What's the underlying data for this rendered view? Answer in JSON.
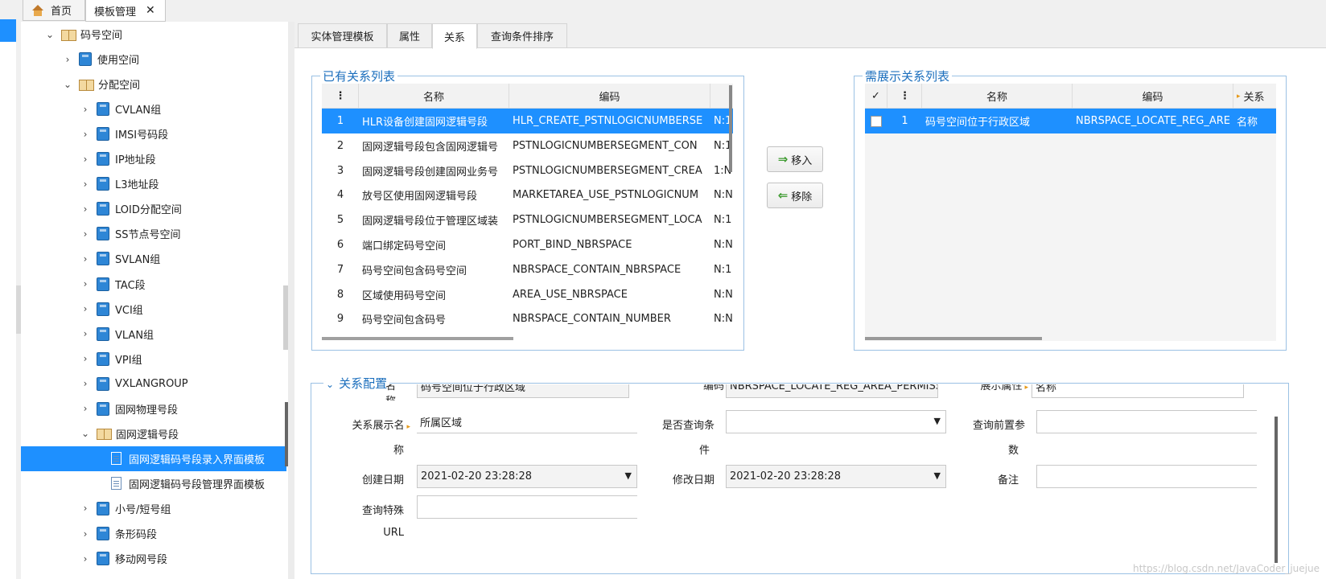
{
  "top_tabs": [
    {
      "label": "首页"
    },
    {
      "label": "模板管理",
      "close": "✕"
    }
  ],
  "tree": {
    "items": [
      {
        "label": "码号空间",
        "icon": "book-icon",
        "chevron": "⌄"
      },
      {
        "label": "使用空间",
        "icon": "folder-icon",
        "chevron": "›"
      },
      {
        "label": "分配空间",
        "icon": "book-icon",
        "chevron": "⌄"
      },
      {
        "label": "CVLAN组",
        "icon": "folder-icon",
        "chevron": "›"
      },
      {
        "label": "IMSI号码段",
        "icon": "folder-icon",
        "chevron": "›"
      },
      {
        "label": "IP地址段",
        "icon": "folder-icon",
        "chevron": "›"
      },
      {
        "label": "L3地址段",
        "icon": "folder-icon",
        "chevron": "›"
      },
      {
        "label": "LOID分配空间",
        "icon": "folder-icon",
        "chevron": "›"
      },
      {
        "label": "SS节点号空间",
        "icon": "folder-icon",
        "chevron": "›"
      },
      {
        "label": "SVLAN组",
        "icon": "folder-icon",
        "chevron": "›"
      },
      {
        "label": "TAC段",
        "icon": "folder-icon",
        "chevron": "›"
      },
      {
        "label": "VCI组",
        "icon": "folder-icon",
        "chevron": "›"
      },
      {
        "label": "VLAN组",
        "icon": "folder-icon",
        "chevron": "›"
      },
      {
        "label": "VPI组",
        "icon": "folder-icon",
        "chevron": "›"
      },
      {
        "label": "VXLANGROUP",
        "icon": "folder-icon",
        "chevron": "›"
      },
      {
        "label": "固网物理号段",
        "icon": "folder-icon",
        "chevron": "›"
      },
      {
        "label": "固网逻辑号段",
        "icon": "book-icon",
        "chevron": "⌄"
      },
      {
        "label": "固网逻辑码号段录入界面模板",
        "icon": "doc-icon",
        "chevron": ""
      },
      {
        "label": "固网逻辑码号段管理界面模板",
        "icon": "doc-icon",
        "chevron": ""
      },
      {
        "label": "小号/短号组",
        "icon": "folder-icon",
        "chevron": "›"
      },
      {
        "label": "条形码段",
        "icon": "folder-icon",
        "chevron": "›"
      },
      {
        "label": "移动网号段",
        "icon": "folder-icon",
        "chevron": "›"
      }
    ]
  },
  "sub_tabs": [
    {
      "label": "实体管理模板"
    },
    {
      "label": "属性"
    },
    {
      "label": "关系"
    },
    {
      "label": "查询条件排序"
    }
  ],
  "existing_list": {
    "legend": "已有关系列表",
    "col_menu": "⋮",
    "headers": [
      "名称",
      "编码"
    ],
    "rows": [
      {
        "no": "1",
        "name": "HLR设备创建固网逻辑号段",
        "code": "HLR_CREATE_PSTNLOGICNUMBERSE",
        "rel": "N:1"
      },
      {
        "no": "2",
        "name": "固网逻辑号段包含固网逻辑号",
        "code": "PSTNLOGICNUMBERSEGMENT_CON",
        "rel": "N:1"
      },
      {
        "no": "3",
        "name": "固网逻辑号段创建固网业务号",
        "code": "PSTNLOGICNUMBERSEGMENT_CREA",
        "rel": "1:N"
      },
      {
        "no": "4",
        "name": "放号区使用固网逻辑号段",
        "code": "MARKETAREA_USE_PSTNLOGICNUM",
        "rel": "N:N"
      },
      {
        "no": "5",
        "name": "固网逻辑号段位于管理区域装",
        "code": "PSTNLOGICNUMBERSEGMENT_LOCA",
        "rel": "N:1"
      },
      {
        "no": "6",
        "name": "端口绑定码号空间",
        "code": "PORT_BIND_NBRSPACE",
        "rel": "N:N"
      },
      {
        "no": "7",
        "name": "码号空间包含码号空间",
        "code": "NBRSPACE_CONTAIN_NBRSPACE",
        "rel": "N:1"
      },
      {
        "no": "8",
        "name": "区域使用码号空间",
        "code": "AREA_USE_NBRSPACE",
        "rel": "N:N"
      },
      {
        "no": "9",
        "name": "码号空间包含码号",
        "code": "NBRSPACE_CONTAIN_NUMBER",
        "rel": "N:N"
      }
    ]
  },
  "buttons": {
    "move_in": "移入",
    "remove": "移除"
  },
  "display_list": {
    "legend": "需展示关系列表",
    "check": "✓",
    "col_menu": "⋮",
    "headers": [
      "名称",
      "编码",
      "关系"
    ],
    "rows": [
      {
        "no": "1",
        "name": "码号空间位于行政区域",
        "code": "NBRSPACE_LOCATE_REG_ARE",
        "attr": "名称"
      }
    ]
  },
  "config": {
    "legend": "关系配置",
    "toggle": "⌄",
    "row0": {
      "name_label": "名称",
      "name_value": "码号空间位于行政区域",
      "code_label": "编码",
      "code_value": "NBRSPACE_LOCATE_REG_AREA_PERMISS",
      "display_attr_label": "展示属性",
      "display_attr_value": "名称"
    },
    "display_name_label_1": "关系展示名",
    "display_name_label_2": "称",
    "display_name_value": "所属区域",
    "is_query_label_1": "是否查询条",
    "is_query_label_2": "件",
    "is_query_value": "",
    "pre_param_label_1": "查询前置参",
    "pre_param_label_2": "数",
    "pre_param_value": "",
    "create_date_label": "创建日期",
    "create_date_value": "2021-02-20 23:28:28",
    "modify_date_label": "修改日期",
    "modify_date_value": "2021-02-20 23:28:28",
    "remark_label": "备注",
    "remark_value": "",
    "special_url_label_1": "查询特殊",
    "special_url_label_2": "URL",
    "special_url_value": ""
  },
  "watermark": "https://blog.csdn.net/JavaCoder_juejue",
  "colors": {
    "accent": "#1e90ff",
    "legend": "#1c6fbd",
    "required": "#e69a1a"
  }
}
